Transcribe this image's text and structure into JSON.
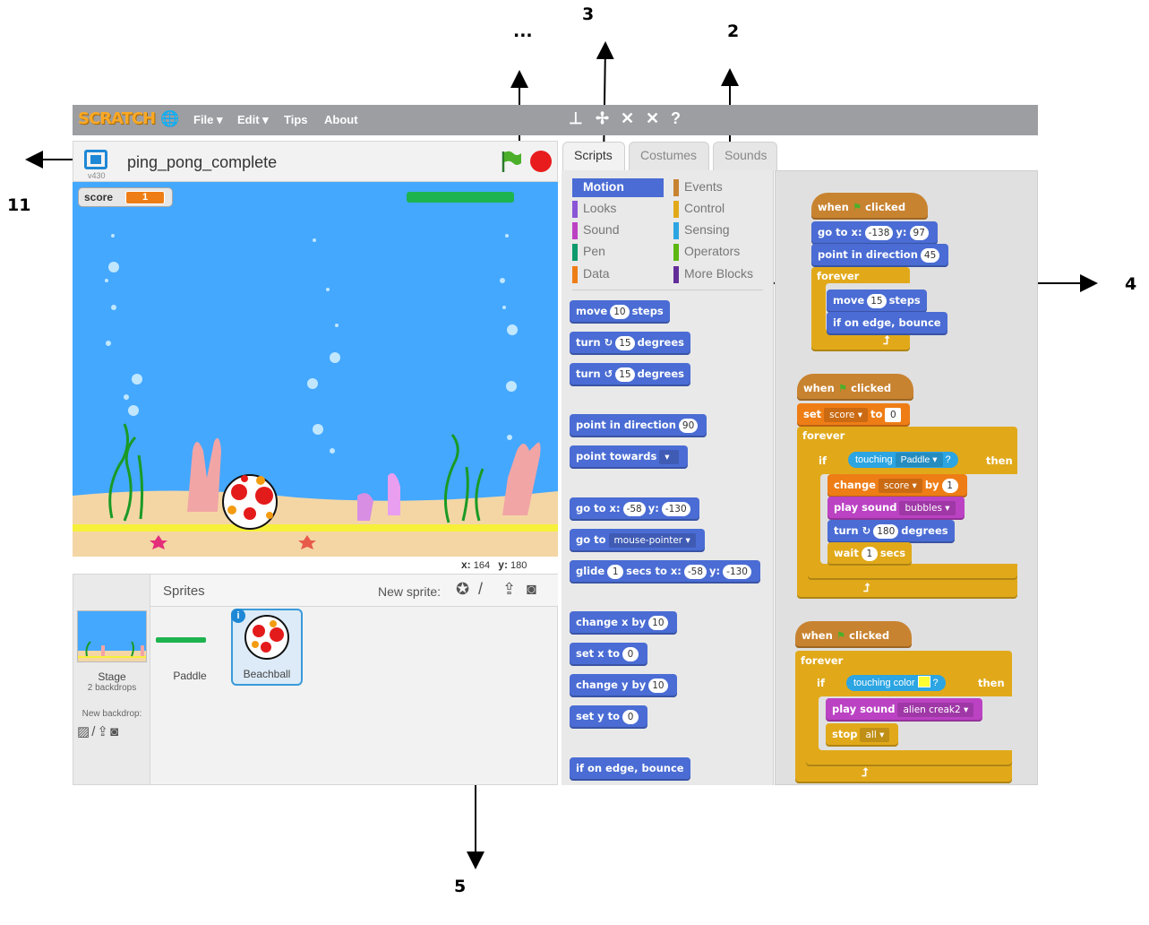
{
  "annotations": {
    "a_dots": "...",
    "a_3": "3",
    "a_2": "2",
    "a_11": "11",
    "a_4": "4",
    "a_5": "5"
  },
  "menubar": {
    "logo": "SCRATCH",
    "file": "File ▾",
    "edit": "Edit ▾",
    "tips": "Tips",
    "about": "About"
  },
  "stage_header": {
    "version": "v430",
    "project_title": "ping_pong_complete"
  },
  "stage": {
    "score_label": "score",
    "score_value": "1"
  },
  "coords": {
    "x_label": "x:",
    "x_value": "164",
    "y_label": "y:",
    "y_value": "180"
  },
  "sprites": {
    "title": "Sprites",
    "new_sprite_label": "New sprite:",
    "stage_label": "Stage",
    "stage_sub": "2 backdrops",
    "new_backdrop_label": "New backdrop:",
    "items": [
      {
        "name": "Paddle"
      },
      {
        "name": "Beachball",
        "badge": "i"
      }
    ]
  },
  "tabs": {
    "scripts": "Scripts",
    "costumes": "Costumes",
    "sounds": "Sounds"
  },
  "categories": [
    {
      "label": "Motion",
      "color": "#4a6cd4"
    },
    {
      "label": "Looks",
      "color": "#8a55d7"
    },
    {
      "label": "Sound",
      "color": "#bb42c3"
    },
    {
      "label": "Pen",
      "color": "#0e9a6c"
    },
    {
      "label": "Data",
      "color": "#ee7d16"
    },
    {
      "label": "Events",
      "color": "#c88330"
    },
    {
      "label": "Control",
      "color": "#e1a91a"
    },
    {
      "label": "Sensing",
      "color": "#2ca5e2"
    },
    {
      "label": "Operators",
      "color": "#5cb712"
    },
    {
      "label": "More Blocks",
      "color": "#632d99"
    }
  ],
  "palette": {
    "move": "move",
    "move_n": "10",
    "steps": "steps",
    "turn": "turn",
    "turn_cw": "↻",
    "turn_ccw": "↺",
    "turn_n": "15",
    "degrees": "degrees",
    "point_dir": "point in direction",
    "point_dir_n": "90",
    "point_towards": "point towards",
    "goto_xy": "go to x:",
    "goto_x": "-58",
    "y_label": "y:",
    "goto_y": "-130",
    "goto": "go to",
    "goto_target": "mouse-pointer",
    "glide": "glide",
    "glide_n": "1",
    "glide_mid": "secs to x:",
    "glide_x": "-58",
    "glide_y": "-130",
    "change_x": "change x by",
    "change_x_n": "10",
    "set_x": "set x to",
    "set_x_n": "0",
    "change_y": "change y by",
    "change_y_n": "10",
    "set_y": "set y to",
    "set_y_n": "0",
    "bounce": "if on edge, bounce"
  },
  "scripts": {
    "when": "when",
    "clicked": "clicked",
    "s1": {
      "goto": "go to x:",
      "x": "-138",
      "y_label": "y:",
      "y": "97",
      "point": "point in direction",
      "dir": "45",
      "forever": "forever",
      "move": "move",
      "move_n": "15",
      "steps": "steps",
      "bounce": "if on edge, bounce"
    },
    "s2": {
      "set": "set",
      "var": "score",
      "to": "to",
      "val": "0",
      "forever": "forever",
      "if": "if",
      "touching": "touching",
      "target": "Paddle",
      "q": "?",
      "then": "then",
      "change": "change",
      "change_var": "score",
      "by": "by",
      "change_n": "1",
      "play": "play sound",
      "sound": "bubbles",
      "turn": "turn",
      "turn_n": "180",
      "degrees": "degrees",
      "wait": "wait",
      "wait_n": "1",
      "secs": "secs"
    },
    "s3": {
      "forever": "forever",
      "if": "if",
      "touching_color": "touching color",
      "q": "?",
      "then": "then",
      "play": "play sound",
      "sound": "alien creak2",
      "stop": "stop",
      "stop_opt": "all"
    }
  }
}
